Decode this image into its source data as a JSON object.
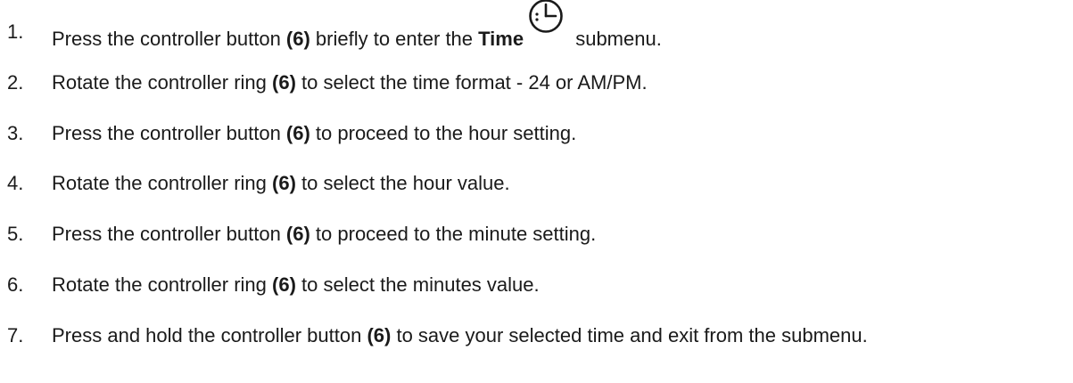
{
  "steps": [
    {
      "number": "1.",
      "pre": "Press the controller button ",
      "ref": "(6)",
      "mid": " briefly to enter the ",
      "bold_word": "Time",
      "icon": "clock-icon",
      "post": " submenu."
    },
    {
      "number": "2.",
      "pre": "Rotate the controller ring ",
      "ref": "(6)",
      "post": " to select the time format - 24 or AM/PM."
    },
    {
      "number": "3.",
      "pre": "Press the controller button ",
      "ref": "(6)",
      "post": " to proceed to the hour setting."
    },
    {
      "number": "4.",
      "pre": "Rotate the controller ring ",
      "ref": "(6)",
      "post": " to select the hour value."
    },
    {
      "number": "5.",
      "pre": "Press the controller button ",
      "ref": "(6)",
      "post": " to proceed to the minute setting."
    },
    {
      "number": "6.",
      "pre": "Rotate the controller ring ",
      "ref": "(6)",
      "post": " to select the minutes value."
    },
    {
      "number": "7.",
      "pre": "Press and hold the controller button ",
      "ref": "(6)",
      "post": " to save your selected time and exit from the submenu."
    }
  ]
}
